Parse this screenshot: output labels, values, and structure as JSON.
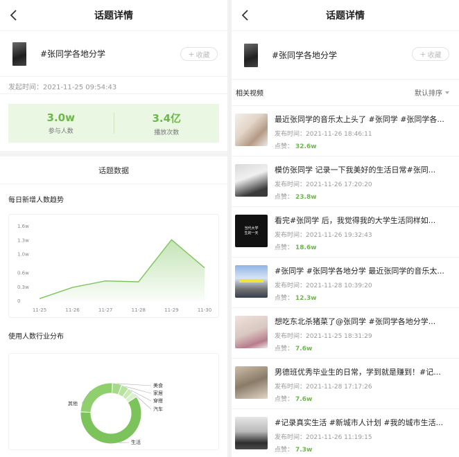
{
  "nav": {
    "title": "话题详情"
  },
  "topic": {
    "name": "#张同学各地分学",
    "fav_label": "收藏"
  },
  "launch": {
    "label": "发起时间：",
    "value": "2021-11-25 09:54:43"
  },
  "stats": [
    {
      "value": "3.0w",
      "label": "参与人数"
    },
    {
      "value": "3.4亿",
      "label": "播放次数"
    }
  ],
  "data_section": {
    "title": "话题数据"
  },
  "trend": {
    "title": "每日新增人数趋势",
    "chart_data": {
      "type": "area",
      "categories": [
        "11-25",
        "11-26",
        "11-27",
        "11-28",
        "11-29",
        "11-30"
      ],
      "y_ticks": [
        "0",
        "0.3w",
        "0.6w",
        "1.0w",
        "1.3w",
        "1.6w"
      ],
      "values": [
        0.04,
        0.28,
        0.42,
        0.4,
        1.3,
        0.7
      ],
      "ylim": [
        0,
        1.6
      ],
      "color": "#7cc35b"
    }
  },
  "industry": {
    "title": "使用人数行业分布",
    "chart_data": {
      "type": "pie",
      "labels": [
        "生活",
        "其他",
        "美食",
        "家居",
        "穿搭",
        "汽车"
      ],
      "values": [
        60,
        25,
        5,
        4,
        3,
        3
      ],
      "colors": [
        "#7cc35b",
        "#8fcf6d",
        "#a6da8a",
        "#b8e2a0",
        "#c9eab6",
        "#d9f1cb"
      ]
    }
  },
  "list": {
    "title": "相关视频",
    "sort_label": "默认排序"
  },
  "videos": [
    {
      "title": "最近张同学的音乐太上头了 #张同学 #张同学各...",
      "time_label": "发布时间：",
      "time": "2021-11-26 18:46:11",
      "likes_label": "点赞：",
      "likes": "32.6w"
    },
    {
      "title": "模仿张同学 记录一下我美好的生活日常#张同...",
      "time_label": "发布时间：",
      "time": "2021-11-26 17:20:20",
      "likes_label": "点赞：",
      "likes": "23.8w"
    },
    {
      "title": "看完#张同学 后，我觉得我的大学生活同样如...",
      "time_label": "发布时间：",
      "time": "2021-11-26 19:32:43",
      "likes_label": "点赞：",
      "likes": "18.6w",
      "thumb_text": "当代大学生的一天"
    },
    {
      "title": "#张同学 #张同学各地分学 最近张同学的音乐太...",
      "time_label": "发布时间：",
      "time": "2021-11-28 10:39:20",
      "likes_label": "点赞：",
      "likes": "12.3w"
    },
    {
      "title": "想吃东北杀猪菜了@张同学 #张同学各地分学...",
      "time_label": "发布时间：",
      "time": "2021-11-25 18:31:29",
      "likes_label": "点赞：",
      "likes": "7.6w"
    },
    {
      "title": "男德班优秀毕业生的日常，学到就是赚到！#记...",
      "time_label": "发布时间：",
      "time": "2021-11-28 17:17:26",
      "likes_label": "点赞：",
      "likes": "7.6w"
    },
    {
      "title": "#记录真实生活 #新城市人计划 #我的城市生活...",
      "time_label": "发布时间：",
      "time": "2021-11-26 11:19:15",
      "likes_label": "点赞：",
      "likes": "7.3w"
    }
  ]
}
